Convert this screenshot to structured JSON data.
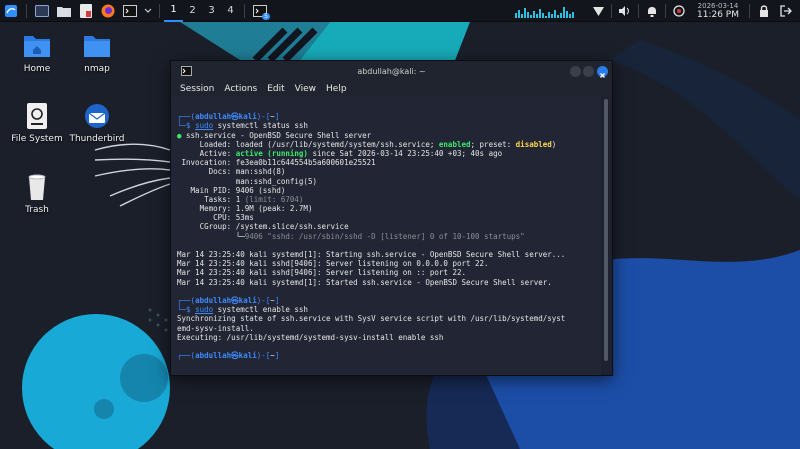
{
  "taskbar": {
    "workspaces": [
      "1",
      "2",
      "3",
      "4"
    ],
    "active_workspace": "1",
    "terminal_badge": "5",
    "clock_date": "2026-03-14",
    "clock_time": "11:26 PM"
  },
  "desktop": {
    "icons": [
      {
        "label": "Home",
        "icon": "folder-icon"
      },
      {
        "label": "nmap",
        "icon": "folder-icon"
      },
      {
        "label": "File System",
        "icon": "drive-icon"
      },
      {
        "label": "Thunderbird",
        "icon": "thunderbird-icon"
      },
      {
        "label": "Trash",
        "icon": "trash-icon"
      }
    ]
  },
  "terminal": {
    "title": "abdullah@kali: ~",
    "menu": [
      "Session",
      "Actions",
      "Edit",
      "View",
      "Help"
    ],
    "prompt": {
      "open": "┌──(",
      "user_host": "abdullah㉿kali",
      "mid": ")-[",
      "dir": "~",
      "close": "]",
      "prefix": "└─$ "
    },
    "cmd1_sudo": "sudo",
    "cmd1_rest": " systemctl status ssh",
    "cmd2_sudo": "sudo",
    "cmd2_rest": " systemctl enable ssh",
    "status": {
      "header": "ssh.service - OpenBSD Secure Shell server",
      "loaded_label": "     Loaded: ",
      "loaded_pre": "loaded (/usr/lib/systemd/system/ssh.service; ",
      "loaded_enabled": "enabled",
      "loaded_mid": "; preset: ",
      "loaded_disabled": "disabled",
      "loaded_post": ")",
      "active_label": "     Active: ",
      "active_state": "active (running)",
      "active_post": " since Sat 2026-03-14 23:25:40 +03; 40s ago",
      "invocation": " Invocation: fe3ea0b11c644554b5a600601e25521",
      "docs1": "       Docs: man:sshd(8)",
      "docs2": "             man:sshd_config(5)",
      "mainpid": "   Main PID: 9406 (sshd)",
      "tasks_pre": "      Tasks: 1 ",
      "tasks_limit": "(limit: 6704)",
      "memory": "     Memory: 1.9M (peak: 2.7M)",
      "cpu": "        CPU: 53ms",
      "cgroup": "     CGroup: /system.slice/ssh.service",
      "cgroup_tree": "             └─",
      "cgroup_proc": "9406 \"sshd: /usr/sbin/sshd -D [listener] 0 of 10-100 startups\""
    },
    "logs": [
      "Mar 14 23:25:40 kali systemd[1]: Starting ssh.service - OpenBSD Secure Shell server...",
      "Mar 14 23:25:40 kali sshd[9406]: Server listening on 0.0.0.0 port 22.",
      "Mar 14 23:25:40 kali sshd[9406]: Server listening on :: port 22.",
      "Mar 14 23:25:40 kali systemd[1]: Started ssh.service - OpenBSD Secure Shell server."
    ],
    "enable_output": [
      "Synchronizing state of ssh.service with SysV service script with /usr/lib/systemd/syst",
      "emd-sysv-install.",
      "Executing: /usr/lib/systemd/systemd-sysv-install enable ssh"
    ]
  },
  "colors": {
    "accent": "#2f8fff",
    "prompt_blue": "#3d8bff",
    "running_green": "#3ce86b",
    "disabled_yellow": "#ffd84a"
  }
}
